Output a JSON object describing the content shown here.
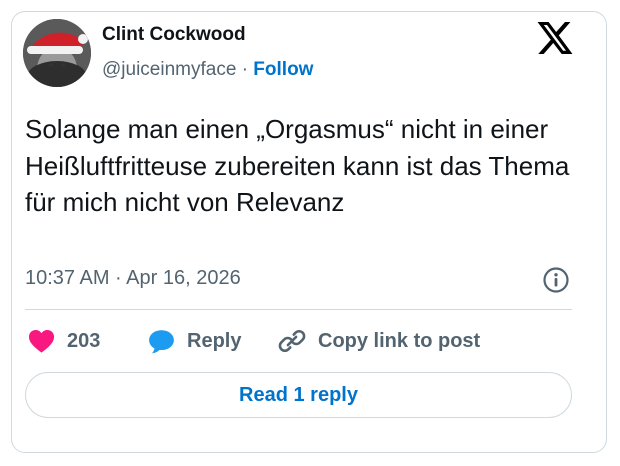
{
  "author": {
    "name": "Clint Cockwood",
    "handle": "@juiceinmyface",
    "separator": "·",
    "follow_label": "Follow"
  },
  "tweet": {
    "text": "Solange man einen „Orgasmus“ nicht in einer Heißluftfritteuse zubereiten kann ist das Thema für mich nicht von Relevanz",
    "timestamp": "10:37 AM · Apr 16, 2026"
  },
  "actions": {
    "like_count": "203",
    "reply_label": "Reply",
    "copy_link_label": "Copy link to post"
  },
  "footer": {
    "read_reply_label": "Read 1 reply"
  },
  "icons": {
    "logo": "x-logo-icon",
    "info": "info-icon",
    "like": "heart-icon",
    "reply": "speech-bubble-icon",
    "copy": "link-icon"
  },
  "colors": {
    "like": "#f91880",
    "reply": "#1d9bf0",
    "link": "#0074cc",
    "text": "#0f1419",
    "muted": "#536471",
    "border": "#cfd9de"
  }
}
